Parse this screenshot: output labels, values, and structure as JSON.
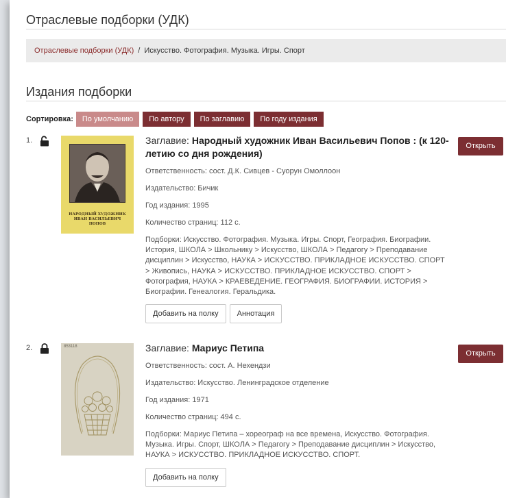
{
  "section_title": "Отраслевые подборки (УДК)",
  "breadcrumb": {
    "link": "Отраслевые подборки (УДК)",
    "separator": "/",
    "current": "Искусство. Фотография. Музыка. Игры. Спорт"
  },
  "subtitle": "Издания подборки",
  "sort": {
    "label": "Сортировка:",
    "options": [
      "По умолчанию",
      "По автору",
      "По заглавию",
      "По году издания"
    ],
    "active": "По умолчанию"
  },
  "items": [
    {
      "number": "1.",
      "lock_state": "unlocked",
      "cover_text": [
        "НАРОДНЫЙ ХУДОЖНИК",
        "ИВАН ВАСИЛЬЕВИЧ",
        "ПОПОВ"
      ],
      "title_prefix": "Заглавие:",
      "title": "Народный художник Иван Васильевич Попов : (к 120-летию со дня рождения)",
      "responsibility": "Ответственность: сост. Д.К. Сивцев - Суорун Омоллоон",
      "publisher": "Издательство: Бичик",
      "year": "Год издания: 1995",
      "pages": "Количество страниц: 112 с.",
      "collections": "Подборки: Искусство. Фотография. Музыка. Игры. Спорт, География. Биографии. История, ШКОЛА > Школьнику > Искусство, ШКОЛА > Педагогу > Преподавание дисциплин > Искусство, НАУКА > ИСКУССТВО. ПРИКЛАДНОЕ ИСКУССТВО. СПОРТ > Живопись, НАУКА > ИСКУССТВО. ПРИКЛАДНОЕ ИСКУССТВО. СПОРТ > Фотография, НАУКА > КРАЕВЕДЕНИЕ. ГЕОГРАФИЯ. БИОГРАФИИ. ИСТОРИЯ > Биографии. Генеалогия. Геральдика.",
      "buttons": [
        "Добавить на полку",
        "Аннотация"
      ],
      "open_label": "Открыть"
    },
    {
      "number": "2.",
      "lock_state": "locked",
      "cover_text": [
        "853118"
      ],
      "title_prefix": "Заглавие:",
      "title": "Мариус Петипа",
      "responsibility": "Ответственность: сост. А. Нехендзи",
      "publisher": "Издательство: Искусство. Ленинградское отделение",
      "year": "Год издания: 1971",
      "pages": "Количество страниц: 494 с.",
      "collections": "Подборки: Мариус Петипа – хореограф на все времена, Искусство. Фотография. Музыка. Игры. Спорт, ШКОЛА > Педагогу > Преподавание дисциплин > Искусство, НАУКА > ИСКУССТВО. ПРИКЛАДНОЕ ИСКУССТВО. СПОРТ.",
      "buttons": [
        "Добавить на полку"
      ],
      "open_label": "Открыть"
    }
  ],
  "colors": {
    "accent": "#7c2e32",
    "accent_active": "#c98a8a",
    "link": "#8a2a2a",
    "cover1_bg": "#e9d96a",
    "cover2_bg": "#d8d3c3"
  }
}
